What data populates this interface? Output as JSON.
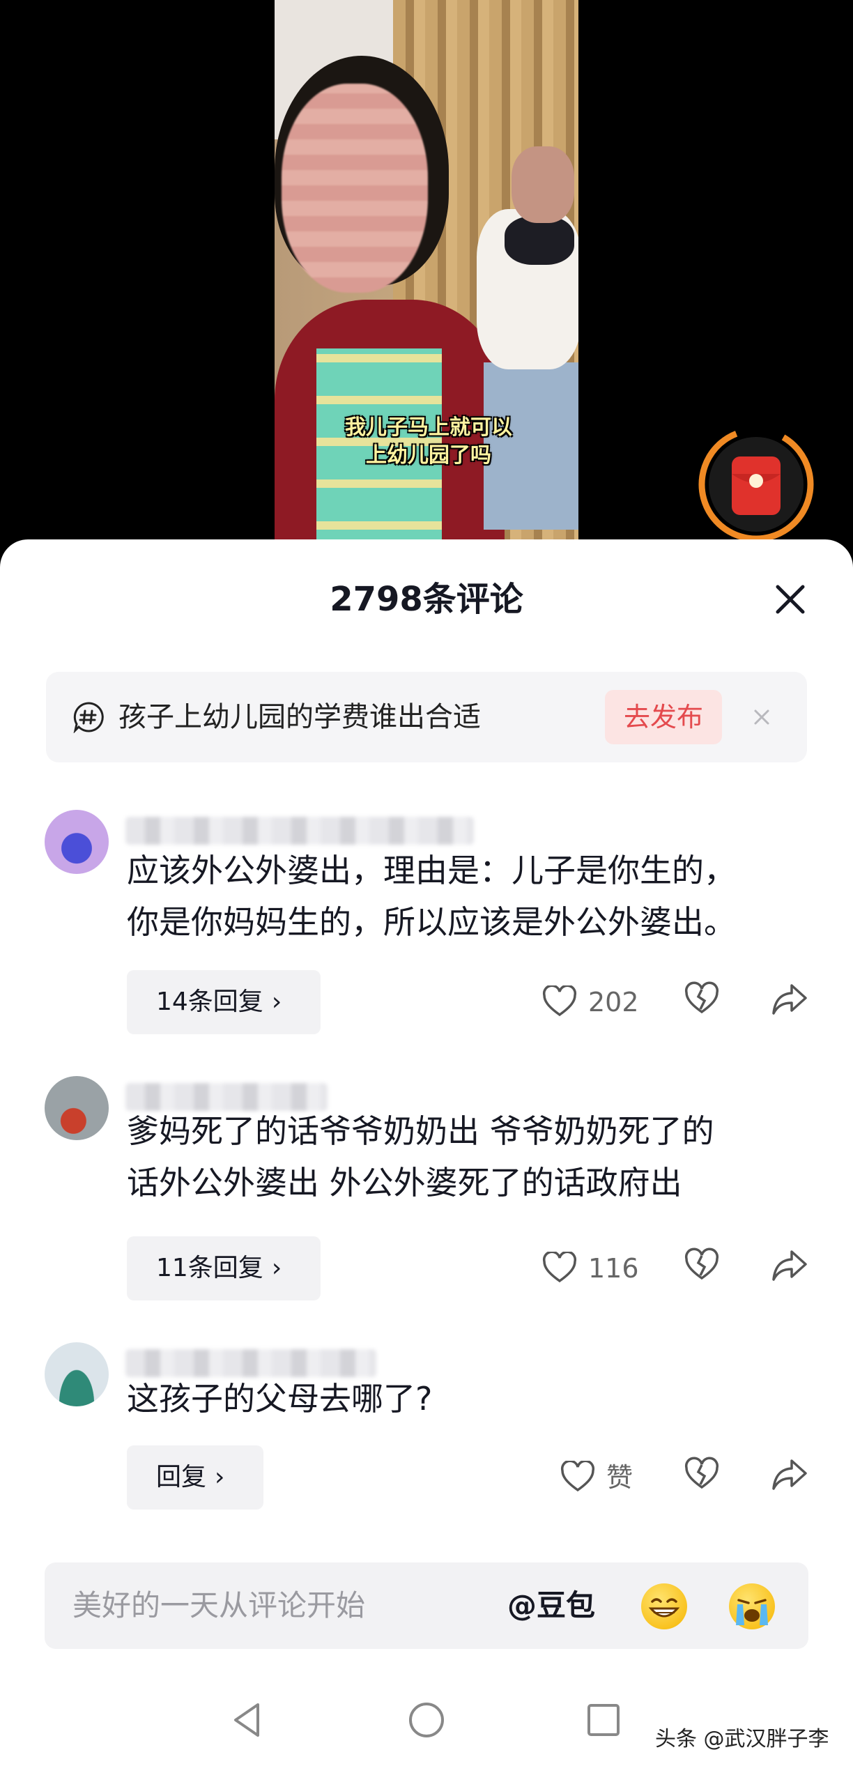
{
  "video": {
    "caption_line1": "我儿子马上就可以",
    "caption_line2": "上幼儿园了吗"
  },
  "sheet": {
    "title": "2798条评论",
    "close_icon": "close-icon"
  },
  "topic": {
    "text": "孩子上幼儿园的学费谁出合适",
    "button_label": "去发布",
    "icon": "hashtag-bubble-icon"
  },
  "comments": [
    {
      "text_line1": "应该外公外婆出，理由是：儿子是你生的，",
      "text_line2": "你是你妈妈生的，所以应该是外公外婆出。",
      "reply_label": "14条回复",
      "likes": "202"
    },
    {
      "text_line1": "爹妈死了的话爷爷奶奶出 爷爷奶奶死了的",
      "text_line2": "话外公外婆出 外公外婆死了的话政府出",
      "reply_label": "11条回复",
      "likes": "116"
    },
    {
      "text_line1": "这孩子的父母去哪了?",
      "reply_label": "回复",
      "likes": "赞"
    }
  ],
  "input": {
    "placeholder": "美好的一天从评论开始",
    "mention": "@豆包"
  },
  "watermark": "头条 @武汉胖子李",
  "colors": {
    "accent_red": "#e44a4e",
    "red_packet_ring": "#f08a24"
  }
}
